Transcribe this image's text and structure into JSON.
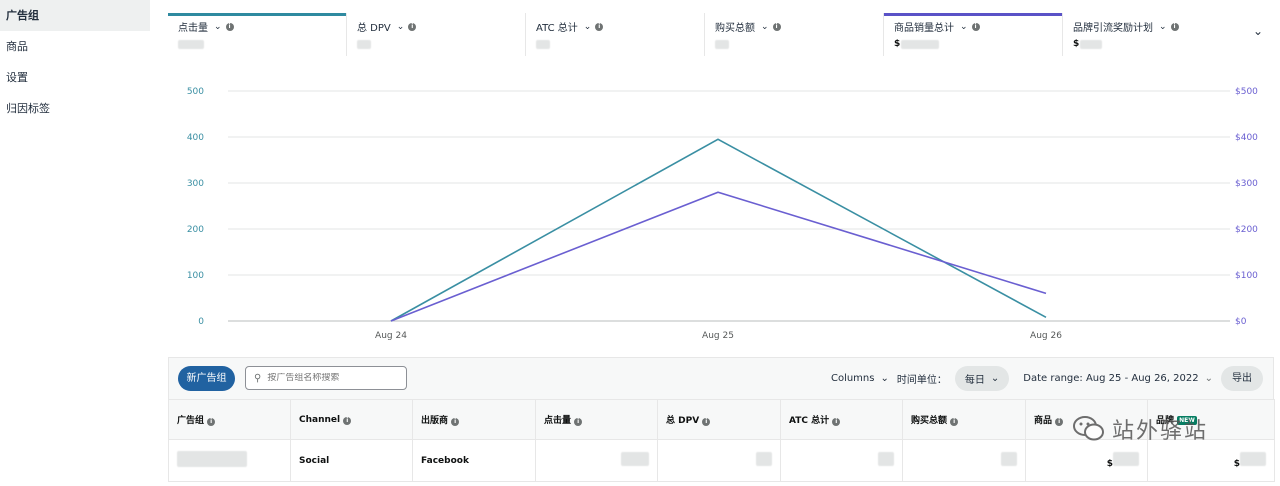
{
  "sidebar": {
    "items": [
      {
        "label": "广告组",
        "active": true
      },
      {
        "label": "商品",
        "active": false
      },
      {
        "label": "设置",
        "active": false
      },
      {
        "label": "归因标签",
        "active": false
      }
    ]
  },
  "metrics": [
    {
      "label": "点击量",
      "prefix": "",
      "selected_color": "#2f8aa0"
    },
    {
      "label": "总 DPV",
      "prefix": "",
      "selected_color": ""
    },
    {
      "label": "ATC 总计",
      "prefix": "",
      "selected_color": ""
    },
    {
      "label": "购买总额",
      "prefix": "",
      "selected_color": ""
    },
    {
      "label": "商品销量总计",
      "prefix": "$",
      "selected_color": "#5a52c7"
    },
    {
      "label": "品牌引流奖励计划",
      "prefix": "$",
      "selected_color": ""
    }
  ],
  "chart_data": {
    "type": "line",
    "x": [
      "Aug 24",
      "Aug 25",
      "Aug 26"
    ],
    "series": [
      {
        "values": [
          0,
          395,
          8
        ],
        "color": "#3a8fa3",
        "axis": "left"
      },
      {
        "values": [
          0,
          280,
          60
        ],
        "color": "#6a5fd1",
        "axis": "right"
      }
    ],
    "y_left": {
      "ticks": [
        "0",
        "100",
        "200",
        "300",
        "400",
        "500"
      ],
      "range": [
        0,
        500
      ]
    },
    "y_right": {
      "ticks": [
        "$0",
        "$100",
        "$200",
        "$300",
        "$400",
        "$500"
      ],
      "range": [
        0,
        500
      ]
    },
    "grid": true
  },
  "toolbar": {
    "new_button": "新广告组",
    "search_placeholder": "按广告组名称搜索",
    "columns_label": "Columns",
    "time_unit_label": "时间单位：",
    "time_unit_value": "每日",
    "date_range": "Date range: Aug 25 - Aug 26, 2022",
    "export_label": "导出"
  },
  "table": {
    "headers": [
      "广告组",
      "Channel",
      "出版商",
      "点击量",
      "总 DPV",
      "ATC 总计",
      "购买总额",
      "商品",
      "品牌"
    ],
    "new_badge": "NEW",
    "row": {
      "channel": "Social",
      "publisher": "Facebook",
      "currency_1": "$",
      "currency_2": "$"
    }
  },
  "watermark": {
    "text": "站外驿站"
  },
  "icons": {
    "info": "info-icon",
    "chevron": "chevron-down-icon",
    "search": "search-icon"
  }
}
